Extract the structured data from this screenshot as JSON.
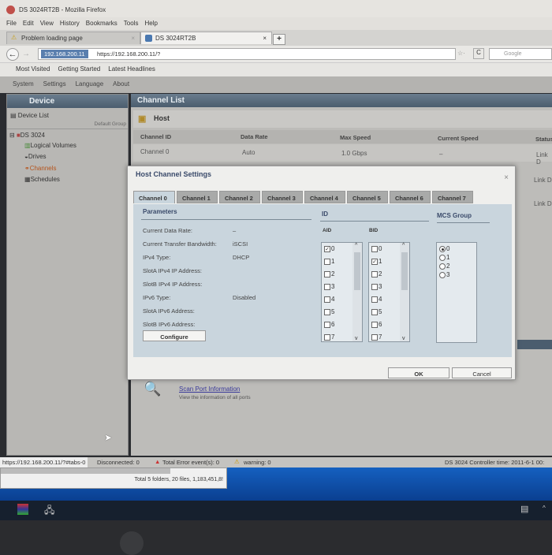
{
  "browser": {
    "title": "DS 3024RT2B - Mozilla Firefox",
    "menu": [
      "File",
      "Edit",
      "View",
      "History",
      "Bookmarks",
      "Tools",
      "Help"
    ],
    "tabs": [
      {
        "label": "Problem loading page"
      },
      {
        "label": "DS 3024RT2B"
      }
    ],
    "new_tab": "+",
    "url_identity": "192.168.200.11",
    "url": "https://192.168.200.11/?",
    "search_placeholder": "Google",
    "bookmarks": [
      "Most Visited",
      "Getting Started",
      "Latest Headlines"
    ]
  },
  "app": {
    "menu": [
      "System",
      "Settings",
      "Language",
      "About"
    ],
    "device_panel": {
      "title": "Device",
      "device_list": "Device List",
      "group": "Default Group",
      "tree": {
        "root": "DS 3024",
        "items": [
          "Logical Volumes",
          "Drives",
          "Channels",
          "Schedules"
        ]
      }
    },
    "channel_list": {
      "title": "Channel List",
      "section": "Host",
      "columns": [
        "Channel ID",
        "Data Rate",
        "Max Speed",
        "Current Speed",
        "Status"
      ],
      "rows": [
        {
          "id": "Channel 0",
          "rate": "Auto",
          "max": "1.0 Gbps",
          "current": "–",
          "status": "Link D"
        }
      ],
      "status_col_extra": [
        "Link D",
        "Link D"
      ]
    },
    "scan": {
      "link": "Scan Port Information",
      "desc": "View the information of all ports"
    }
  },
  "dialog": {
    "title": "Host Channel Settings",
    "close": "×",
    "tabs": [
      "Channel 0",
      "Channel 1",
      "Channel 2",
      "Channel 3",
      "Channel 4",
      "Channel 5",
      "Channel 6",
      "Channel 7"
    ],
    "params_title": "Parameters",
    "params": [
      {
        "label": "Current Data Rate:",
        "value": "–"
      },
      {
        "label": "Current Transfer Bandwidth:",
        "value": "iSCSI"
      },
      {
        "label": "IPv4 Type:",
        "value": "DHCP"
      },
      {
        "label": "SlotA IPv4 IP Address:",
        "value": ""
      },
      {
        "label": "SlotB IPv4 IP Address:",
        "value": ""
      },
      {
        "label": "IPv6 Type:",
        "value": "Disabled"
      },
      {
        "label": "SlotA IPv6 Address:",
        "value": ""
      },
      {
        "label": "SlotB IPv6 Address:",
        "value": ""
      }
    ],
    "configure": "Configure",
    "id_title": "ID",
    "aid_label": "AID",
    "bid_label": "BID",
    "aid": [
      {
        "n": "0",
        "checked": true
      },
      {
        "n": "1",
        "checked": false
      },
      {
        "n": "2",
        "checked": false
      },
      {
        "n": "3",
        "checked": false
      },
      {
        "n": "4",
        "checked": false
      },
      {
        "n": "5",
        "checked": false
      },
      {
        "n": "6",
        "checked": false
      },
      {
        "n": "7",
        "checked": false
      }
    ],
    "bid": [
      {
        "n": "0",
        "checked": false
      },
      {
        "n": "1",
        "checked": true
      },
      {
        "n": "2",
        "checked": false
      },
      {
        "n": "3",
        "checked": false
      },
      {
        "n": "4",
        "checked": false
      },
      {
        "n": "5",
        "checked": false
      },
      {
        "n": "6",
        "checked": false
      },
      {
        "n": "7",
        "checked": false
      }
    ],
    "mcs_title": "MCS Group",
    "mcs": [
      {
        "n": "0",
        "selected": true
      },
      {
        "n": "1",
        "selected": false
      },
      {
        "n": "2",
        "selected": false
      },
      {
        "n": "3",
        "selected": false
      }
    ],
    "ok": "OK",
    "cancel": "Cancel"
  },
  "status": {
    "url": "https://192.168.200.11/?#tabs-0",
    "disconnected": "Disconnected: 0",
    "errors": "Total Error event(s): 0",
    "warnings": "warning: 0",
    "controller": "DS 3024  Controller time: 2011-6-1 00:"
  },
  "explorer": {
    "summary": "Total 5 folders, 20 files, 1,183,451,8!"
  }
}
